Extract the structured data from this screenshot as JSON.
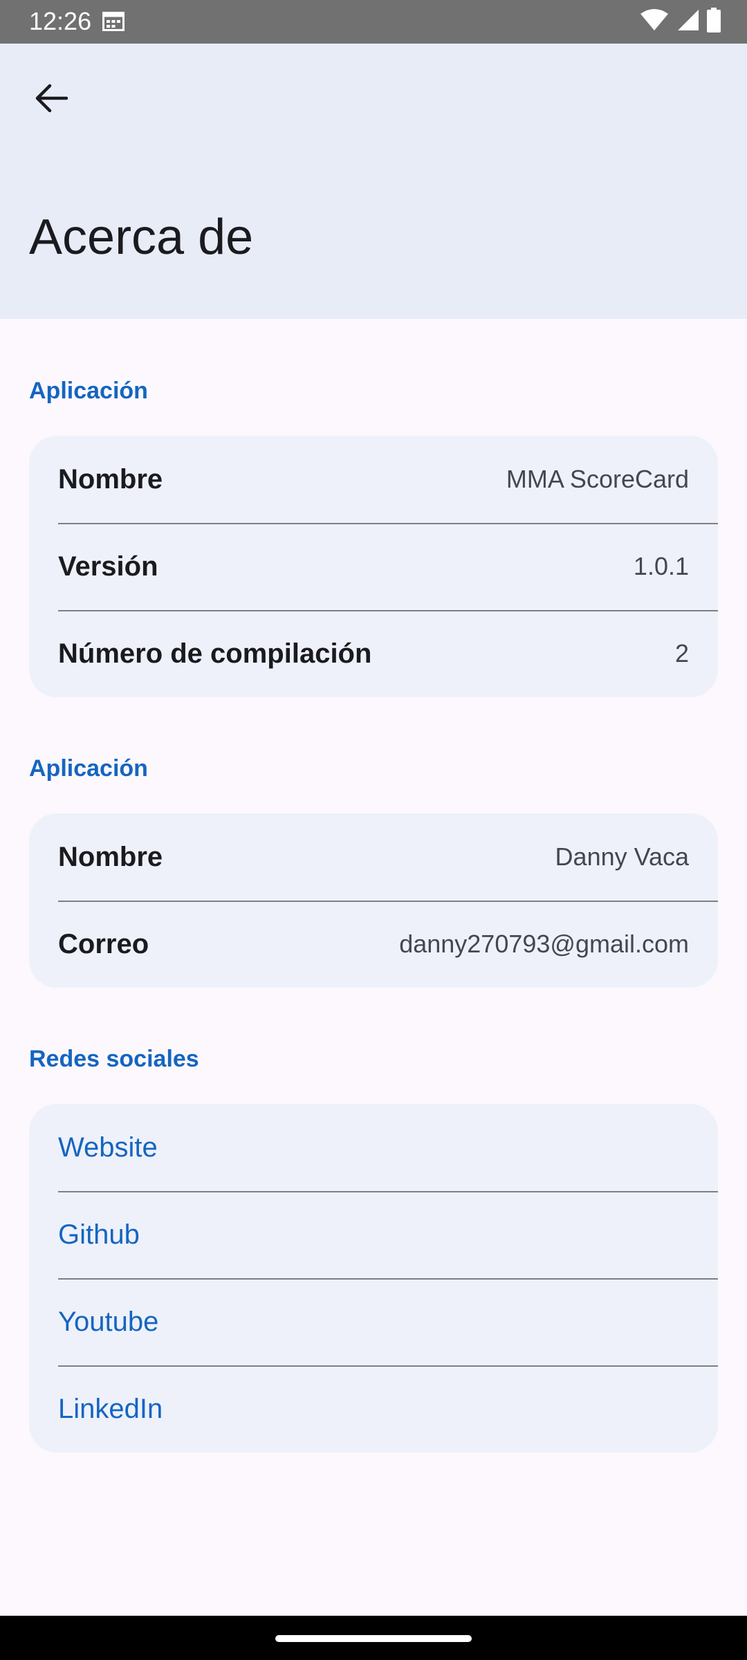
{
  "status_bar": {
    "time": "12:26",
    "icons": [
      "calendar-icon",
      "wifi-icon",
      "signal-icon",
      "battery-icon"
    ]
  },
  "header": {
    "title": "Acerca de",
    "back_icon": "arrow-left-icon"
  },
  "sections": {
    "app": {
      "label": "Aplicación",
      "rows": [
        {
          "key": "Nombre",
          "value": "MMA ScoreCard"
        },
        {
          "key": "Versión",
          "value": "1.0.1"
        },
        {
          "key": "Número de compilación",
          "value": "2"
        }
      ]
    },
    "author": {
      "label": "Aplicación",
      "rows": [
        {
          "key": "Nombre",
          "value": "Danny Vaca"
        },
        {
          "key": "Correo",
          "value": "danny270793@gmail.com"
        }
      ]
    },
    "social": {
      "label": "Redes sociales",
      "links": [
        "Website",
        "Github",
        "Youtube",
        "LinkedIn"
      ]
    }
  },
  "colors": {
    "accent": "#1565c0",
    "header_bg": "#e8ecf7",
    "card_bg": "#eef1fa",
    "page_bg": "#fcf8fd"
  }
}
